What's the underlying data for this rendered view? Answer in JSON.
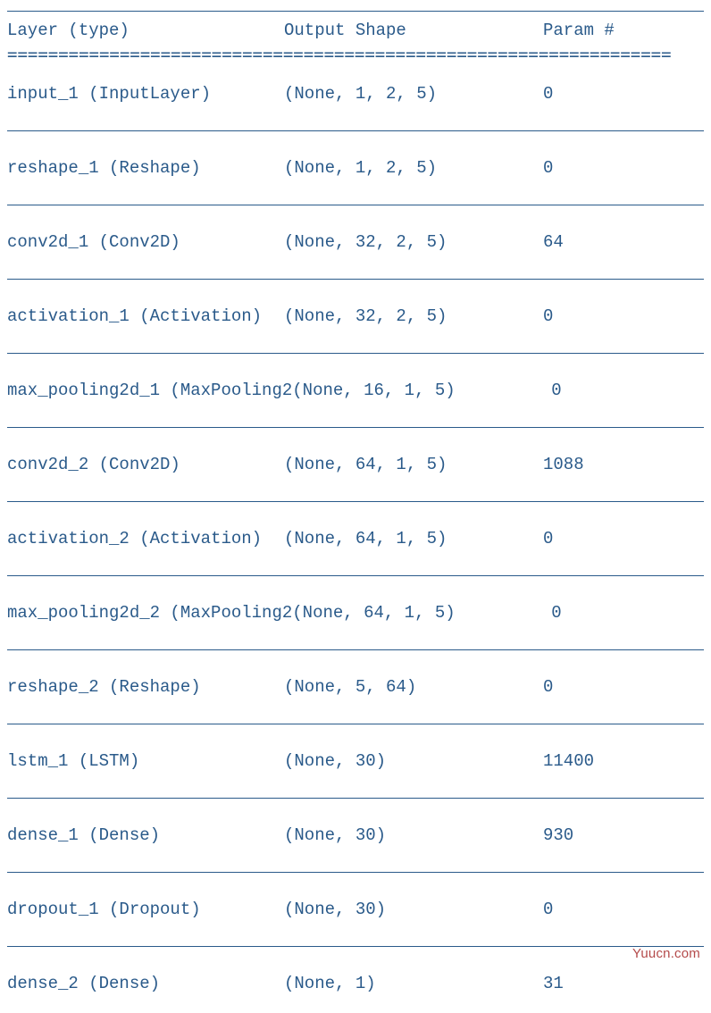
{
  "chart_data": {
    "type": "table",
    "columns": [
      "Layer (type)",
      "Output Shape",
      "Param #"
    ],
    "rows": [
      [
        "input_1 (InputLayer)",
        "(None, 1, 2, 5)",
        "0"
      ],
      [
        "reshape_1 (Reshape)",
        "(None, 1, 2, 5)",
        "0"
      ],
      [
        "conv2d_1 (Conv2D)",
        "(None, 32, 2, 5)",
        "64"
      ],
      [
        "activation_1 (Activation)",
        "(None, 32, 2, 5)",
        "0"
      ],
      [
        "max_pooling2d_1 (MaxPooling2",
        "(None, 16, 1, 5)",
        "0"
      ],
      [
        "conv2d_2 (Conv2D)",
        "(None, 64, 1, 5)",
        "1088"
      ],
      [
        "activation_2 (Activation)",
        "(None, 64, 1, 5)",
        "0"
      ],
      [
        "max_pooling2d_2 (MaxPooling2",
        "(None, 64, 1, 5)",
        "0"
      ],
      [
        "reshape_2 (Reshape)",
        "(None, 5, 64)",
        "0"
      ],
      [
        "lstm_1 (LSTM)",
        "(None, 30)",
        "11400"
      ],
      [
        "dense_1 (Dense)",
        "(None, 30)",
        "930"
      ],
      [
        "dropout_1 (Dropout)",
        "(None, 30)",
        "0"
      ],
      [
        "dense_2 (Dense)",
        "(None, 1)",
        "31"
      ]
    ]
  },
  "headers": {
    "layer": "Layer (type)",
    "shape": "Output Shape",
    "param": "Param #"
  },
  "double_line": "=================================================================",
  "rows": [
    {
      "layer": "input_1 (InputLayer)",
      "shape": "(None, 1, 2, 5)",
      "param": "0"
    },
    {
      "layer": "reshape_1 (Reshape)",
      "shape": "(None, 1, 2, 5)",
      "param": "0"
    },
    {
      "layer": "conv2d_1 (Conv2D)",
      "shape": "(None, 32, 2, 5)",
      "param": "64"
    },
    {
      "layer": "activation_1 (Activation)",
      "shape": "(None, 32, 2, 5)",
      "param": "0"
    },
    {
      "layer": "max_pooling2d_1 (MaxPooling2",
      "shape": "(None, 16, 1, 5)",
      "param": "0"
    },
    {
      "layer": "conv2d_2 (Conv2D)",
      "shape": "(None, 64, 1, 5)",
      "param": "1088"
    },
    {
      "layer": "activation_2 (Activation)",
      "shape": "(None, 64, 1, 5)",
      "param": "0"
    },
    {
      "layer": "max_pooling2d_2 (MaxPooling2",
      "shape": "(None, 64, 1, 5)",
      "param": "0"
    },
    {
      "layer": "reshape_2 (Reshape)",
      "shape": "(None, 5, 64)",
      "param": "0"
    },
    {
      "layer": "lstm_1 (LSTM)",
      "shape": "(None, 30)",
      "param": "11400"
    },
    {
      "layer": "dense_1 (Dense)",
      "shape": "(None, 30)",
      "param": "930"
    },
    {
      "layer": "dropout_1 (Dropout)",
      "shape": "(None, 30)",
      "param": "0"
    },
    {
      "layer": "dense_2 (Dense)",
      "shape": "(None, 1)",
      "param": "31"
    }
  ],
  "watermark": "Yuucn.com"
}
